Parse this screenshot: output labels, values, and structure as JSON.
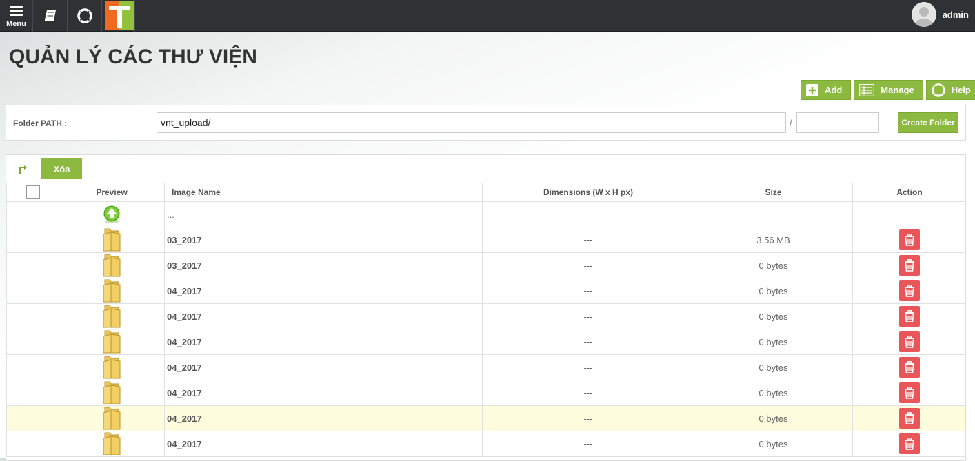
{
  "topbar": {
    "menu_label": "Menu",
    "user_name": "admin"
  },
  "page": {
    "title": "QUẢN LÝ CÁC THƯ VIỆN"
  },
  "actions": {
    "add_label": "Add",
    "manage_label": "Manage",
    "help_label": "Help"
  },
  "folder_path": {
    "label": "Folder PATH :",
    "value": "vnt_upload/",
    "separator": "/",
    "new_folder_value": "",
    "create_label": "Create Folder"
  },
  "list": {
    "delete_label": "Xóa",
    "columns": {
      "preview": "Preview",
      "name": "Image Name",
      "dimensions": "Dimensions (W x H px)",
      "size": "Size",
      "action": "Action"
    },
    "parent_row": {
      "name": "..."
    },
    "rows": [
      {
        "name": "03_2017",
        "dimensions": "---",
        "size": "3.56 MB"
      },
      {
        "name": "03_2017",
        "dimensions": "---",
        "size": "0 bytes"
      },
      {
        "name": "04_2017",
        "dimensions": "---",
        "size": "0 bytes"
      },
      {
        "name": "04_2017",
        "dimensions": "---",
        "size": "0 bytes"
      },
      {
        "name": "04_2017",
        "dimensions": "---",
        "size": "0 bytes"
      },
      {
        "name": "04_2017",
        "dimensions": "---",
        "size": "0 bytes"
      },
      {
        "name": "04_2017",
        "dimensions": "---",
        "size": "0 bytes"
      },
      {
        "name": "04_2017",
        "dimensions": "---",
        "size": "0 bytes"
      },
      {
        "name": "04_2017",
        "dimensions": "---",
        "size": "0 bytes"
      }
    ],
    "highlighted_row_index": 7
  },
  "colors": {
    "topbar": "#2f3134",
    "accent_green": "#8cb93f",
    "delete_red": "#e8565a",
    "logo_orange": "#f06a22",
    "logo_green": "#93c13d",
    "row_highlight": "#fdfdde"
  }
}
